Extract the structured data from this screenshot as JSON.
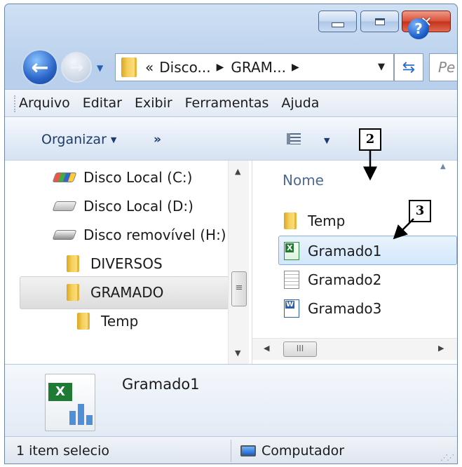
{
  "window": {
    "controls": {
      "minimize_icon": "minimize-icon",
      "maximize_icon": "maximize-icon",
      "close_icon": "close-icon"
    }
  },
  "address_bar": {
    "overflow": "«",
    "crumbs": [
      "Disco...",
      "GRAM..."
    ],
    "search_placeholder": "Pe"
  },
  "menu": [
    "Arquivo",
    "Editar",
    "Exibir",
    "Ferramentas",
    "Ajuda"
  ],
  "toolbar": {
    "organize_label": "Organizar",
    "more_label": "»",
    "help_label": "?"
  },
  "nav_pane": {
    "items": [
      {
        "label": "Disco Local (C:)",
        "icon": "windows-drive-icon"
      },
      {
        "label": "Disco Local (D:)",
        "icon": "hard-drive-icon"
      },
      {
        "label": "Disco removível (H:)",
        "icon": "removable-drive-icon"
      },
      {
        "label": "DIVERSOS",
        "icon": "folder-icon"
      },
      {
        "label": "GRAMADO",
        "icon": "folder-icon",
        "selected": true
      },
      {
        "label": "Temp",
        "icon": "folder-icon"
      }
    ],
    "scroll_thumb": "≡"
  },
  "file_pane": {
    "column_header": "Nome",
    "files": [
      {
        "name": "Temp",
        "icon": "folder-icon"
      },
      {
        "name": "Gramado1",
        "icon": "excel-file-icon",
        "selected": true
      },
      {
        "name": "Gramado2",
        "icon": "text-file-icon"
      },
      {
        "name": "Gramado3",
        "icon": "word-file-icon"
      }
    ],
    "hscroll_thumb": "III"
  },
  "details": {
    "file_name": "Gramado1",
    "icon": "excel-file-large-icon",
    "badge": "X"
  },
  "statusbar": {
    "left": "1 item selecio",
    "right": "Computador"
  },
  "annotations": {
    "callout_2": "2",
    "callout_3": "3"
  }
}
